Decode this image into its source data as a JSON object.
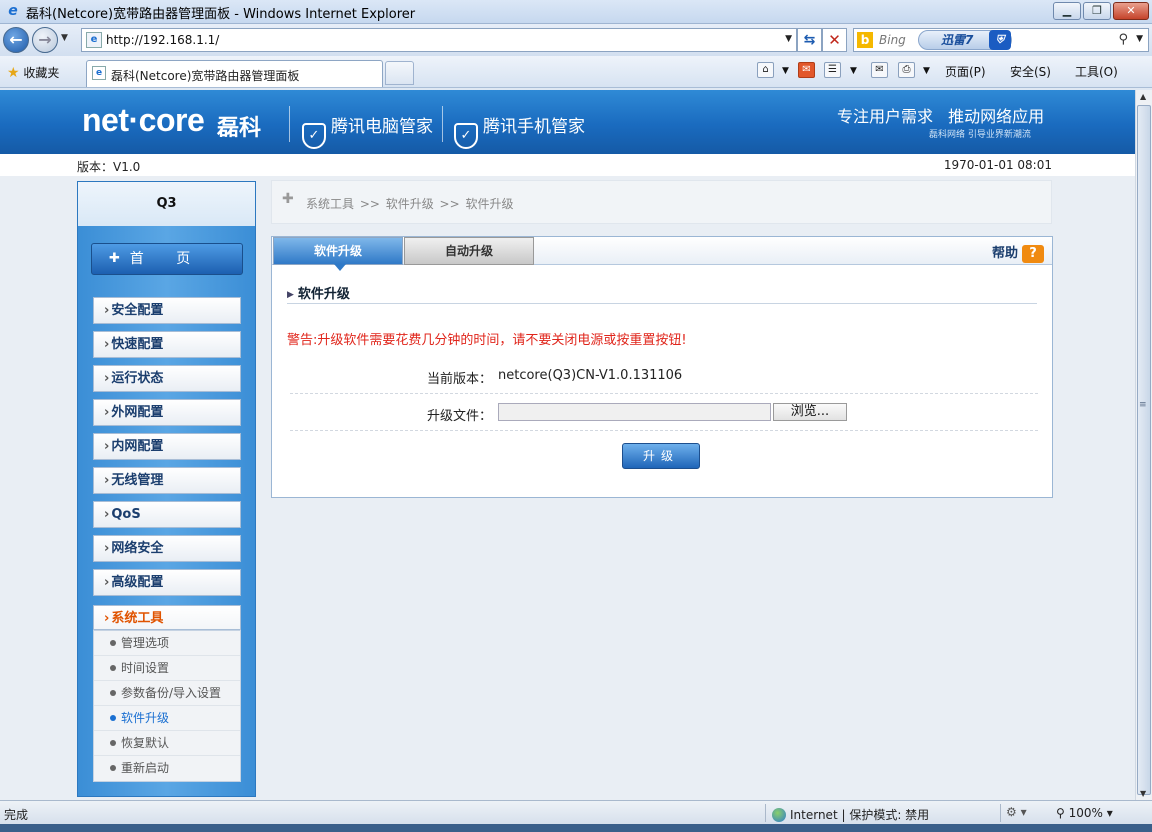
{
  "window": {
    "title": "磊科(Netcore)宽带路由器管理面板 - Windows Internet Explorer",
    "min_icon": "minimize-icon",
    "max_icon": "maximize-icon",
    "close_icon": "close-icon"
  },
  "browser": {
    "url": "http://192.168.1.1/",
    "search_engine": "Bing",
    "xunlei_label": "迅雷7",
    "favorites_label": "收藏夹",
    "tab_title": "磊科(Netcore)宽带路由器管理面板",
    "commands": {
      "page": "页面(P)",
      "safety": "安全(S)",
      "tools": "工具(O)"
    }
  },
  "header": {
    "logo": "net·core",
    "logo_cn": "磊科",
    "partner1": "腾讯电脑管家",
    "partner2": "腾讯手机管家",
    "slogan": "专注用户需求 推动网络应用",
    "slogan_sub": "磊科网络 引导业界新潮流"
  },
  "info": {
    "version": "版本：V1.0",
    "clock": "1970-01-01 08:01"
  },
  "sidebar": {
    "model": "Q3",
    "home": "首 页",
    "items": [
      {
        "label": "安全配置"
      },
      {
        "label": "快速配置"
      },
      {
        "label": "运行状态"
      },
      {
        "label": "外网配置"
      },
      {
        "label": "内网配置"
      },
      {
        "label": "无线管理"
      },
      {
        "label": "QoS"
      },
      {
        "label": "网络安全"
      },
      {
        "label": "高级配置"
      },
      {
        "label": "系统工具"
      }
    ],
    "submenu": [
      {
        "label": "管理选项"
      },
      {
        "label": "时间设置"
      },
      {
        "label": "参数备份/导入设置"
      },
      {
        "label": "软件升级"
      },
      {
        "label": "恢复默认"
      },
      {
        "label": "重新启动"
      }
    ],
    "active_item": "系统工具",
    "active_sub": "软件升级"
  },
  "breadcrumb": "系统工具 >> 软件升级 >> 软件升级",
  "panel": {
    "tabs": [
      "软件升级",
      "自动升级"
    ],
    "help": "帮助",
    "section_title": "软件升级",
    "warning": "警告:升级软件需要花费几分钟的时间，请不要关闭电源或按重置按钮!",
    "current_version_label": "当前版本：",
    "current_version_value": "netcore(Q3)CN-V1.0.131106",
    "file_label": "升级文件：",
    "file_value": "",
    "browse": "浏览...",
    "upgrade": "升级"
  },
  "statusbar": {
    "done": "完成",
    "zone": "Internet | 保护模式: 禁用",
    "zoom": "100%"
  },
  "colors": {
    "brand_blue": "#1a6bbf",
    "warning_red": "#e0251b",
    "active_orange": "#e05300",
    "help_orange": "#f08a10"
  }
}
